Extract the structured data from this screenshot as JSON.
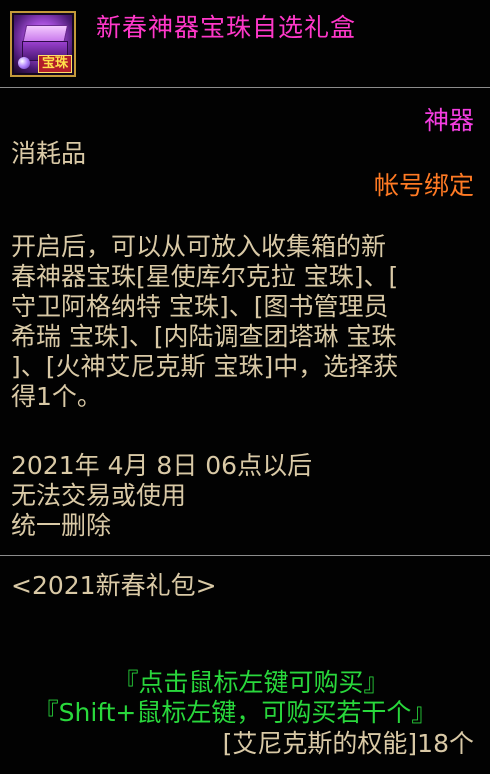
{
  "item": {
    "title": "新春神器宝珠自选礼盒",
    "icon_name": "gift-box-icon",
    "icon_tag": "宝珠",
    "rarity": "神器",
    "type": "消耗品",
    "binding": "帐号绑定"
  },
  "description_lines": [
    "开启后，可以从可放入收集箱的新",
    "春神器宝珠[星使库尔克拉 宝珠]、[",
    "守卫阿格纳特 宝珠]、[图书管理员",
    "希瑞 宝珠]、[内陆调查团塔琳 宝珠",
    "]、[火神艾尼克斯 宝珠]中，选择获",
    "得1个。"
  ],
  "expire_lines": [
    "2021年 4月 8日 06点以后",
    "无法交易或使用",
    "统一删除"
  ],
  "pack_name": "<2021新春礼包>",
  "purchase": {
    "hint_click": "『点击鼠标左键可购买』",
    "hint_shift": "『Shift+鼠标左键，可购买若干个』",
    "owned": "[艾尼克斯的权能]18个"
  },
  "colors": {
    "title": "#ff38c9",
    "rarity": "#f33ee0",
    "binding": "#ff7a24",
    "body_text": "#d9c9a6",
    "hint": "#29d83c",
    "divider": "#8c8c8c",
    "background": "#020202"
  }
}
